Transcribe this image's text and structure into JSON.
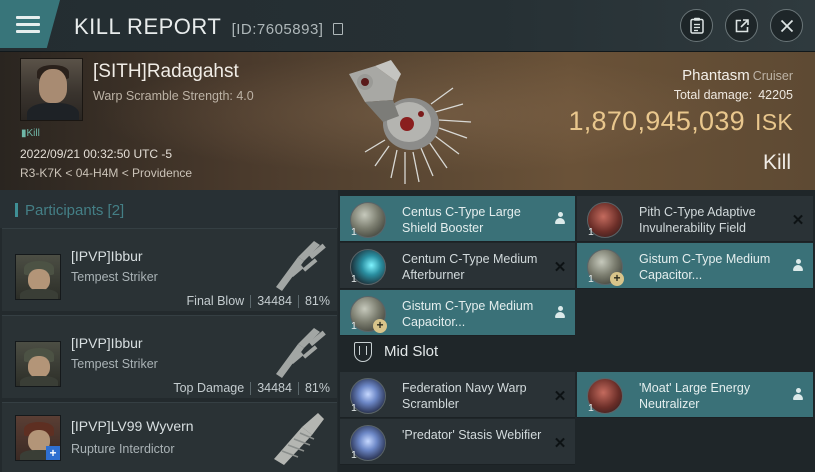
{
  "header": {
    "title": "KILL REPORT",
    "report_id": "[ID:7605893]"
  },
  "victim": {
    "name": "[SITH]Radagahst",
    "warp_scramble": "Warp Scramble Strength: 4.0",
    "tag": "Kill",
    "datetime": "2022/09/21 00:32:50 UTC -5",
    "location": "R3-K7K < 04-H4M < Providence",
    "ship_name": "Phantasm",
    "ship_class": "Cruiser",
    "total_damage_label": "Total damage:",
    "total_damage": "42205",
    "isk_value": "1,870,945,039",
    "isk_unit": "ISK",
    "result": "Kill"
  },
  "participants": {
    "label": "Participants",
    "count": "[2]",
    "items": [
      {
        "name": "[IPVP]Ibbur",
        "ship": "Tempest Striker",
        "role": "Final Blow",
        "damage": "34484",
        "percent": "81%"
      },
      {
        "name": "[IPVP]Ibbur",
        "ship": "Tempest Striker",
        "role": "Top Damage",
        "damage": "34484",
        "percent": "81%"
      },
      {
        "name": "[IPVP]LV99 Wyvern",
        "ship": "Rupture Interdictor"
      }
    ]
  },
  "modules": {
    "low_left": [
      {
        "qty": "1",
        "name": "Centus C-Type Large Shield Booster",
        "icon": "shield-booster-icon",
        "state": "dropped"
      },
      {
        "qty": "1",
        "name": "Centum C-Type Medium Afterburner",
        "icon": "afterburner-icon",
        "state": "destroyed"
      },
      {
        "qty": "1",
        "name": "Gistum C-Type Medium Capacitor...",
        "icon": "capacitor-booster-icon",
        "state": "dropped"
      }
    ],
    "low_right": [
      {
        "qty": "1",
        "name": "Pith C-Type Adaptive Invulnerability Field",
        "icon": "invulnerability-field-icon",
        "state": "destroyed"
      },
      {
        "qty": "1",
        "name": "Gistum C-Type Medium Capacitor...",
        "icon": "capacitor-booster-icon",
        "state": "dropped"
      }
    ],
    "mid_slot_label": "Mid Slot",
    "mid_left": [
      {
        "qty": "1",
        "name": "Federation Navy Warp Scrambler",
        "icon": "warp-scrambler-icon",
        "state": "destroyed"
      },
      {
        "qty": "1",
        "name": "'Predator' Stasis Webifier",
        "icon": "stasis-webifier-icon",
        "state": "destroyed"
      }
    ],
    "mid_right": [
      {
        "qty": "1",
        "name": "'Moat' Large Energy Neutralizer",
        "icon": "energy-neutralizer-icon",
        "state": "dropped"
      }
    ]
  }
}
